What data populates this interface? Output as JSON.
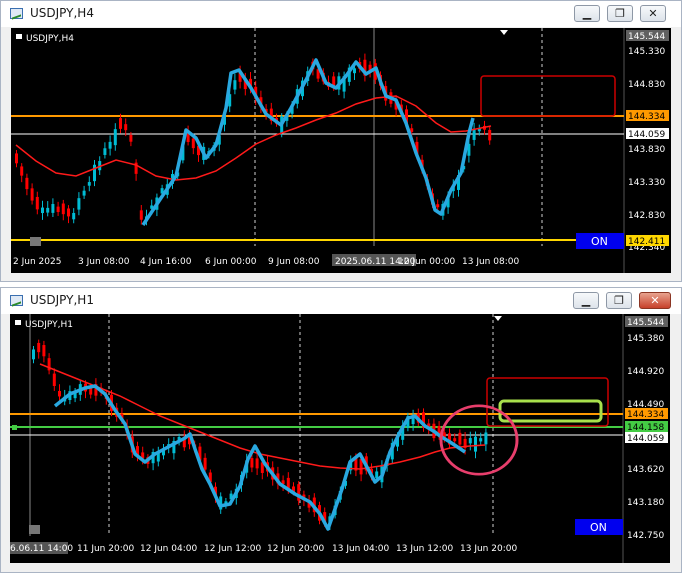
{
  "charts": [
    {
      "window_title": "USDJPY,H4",
      "symbol_label": "USDJPY,H4",
      "price_labels": [
        "145.544",
        "145.330",
        "144.830",
        "143.830",
        "143.330",
        "142.830",
        "142.340"
      ],
      "time_labels": [
        "2 Jun 2025",
        "3 Jun 08:00",
        "4 Jun 16:00",
        "6 Jun 00:00",
        "9 Jun 08:00",
        "2025.06.11 14:00",
        "12 Jun 00:00",
        "13 Jun 08:00"
      ],
      "hline_labels": {
        "orange": "144.334",
        "white": "144.059",
        "yellow": "142.411"
      },
      "on_label": "ON",
      "colors": {
        "bull": "#00bcd4",
        "bear": "#ff0000",
        "ma": "#ff1a1a",
        "zigzag": "#29a8e0",
        "orange": "#ff9900",
        "yellow": "#ffd700",
        "box": "#cc0000"
      }
    },
    {
      "window_title": "USDJPY,H1",
      "symbol_label": "USDJPY,H1",
      "price_labels": [
        "145.544",
        "145.380",
        "144.920",
        "144.490",
        "143.620",
        "143.180",
        "142.750"
      ],
      "time_labels": [
        "6.06.11 14:00",
        "11 Jun 20:00",
        "12 Jun 04:00",
        "12 Jun 12:00",
        "12 Jun 20:00",
        "13 Jun 04:00",
        "13 Jun 12:00",
        "13 Jun 20:00"
      ],
      "hline_labels": {
        "orange": "144.334",
        "green": "144.158",
        "white": "144.059"
      },
      "on_label": "ON",
      "colors": {
        "bull": "#00bcd4",
        "bear": "#ff0000",
        "ma": "#ff1a1a",
        "zigzag": "#29a8e0",
        "orange": "#ff9900",
        "green": "#44cc44",
        "box": "#cc0000",
        "green_box": "#a8e04c",
        "circle": "#e83e6c"
      }
    }
  ],
  "controls": {
    "minimize": "▁",
    "restore": "❐",
    "close": "✕"
  }
}
